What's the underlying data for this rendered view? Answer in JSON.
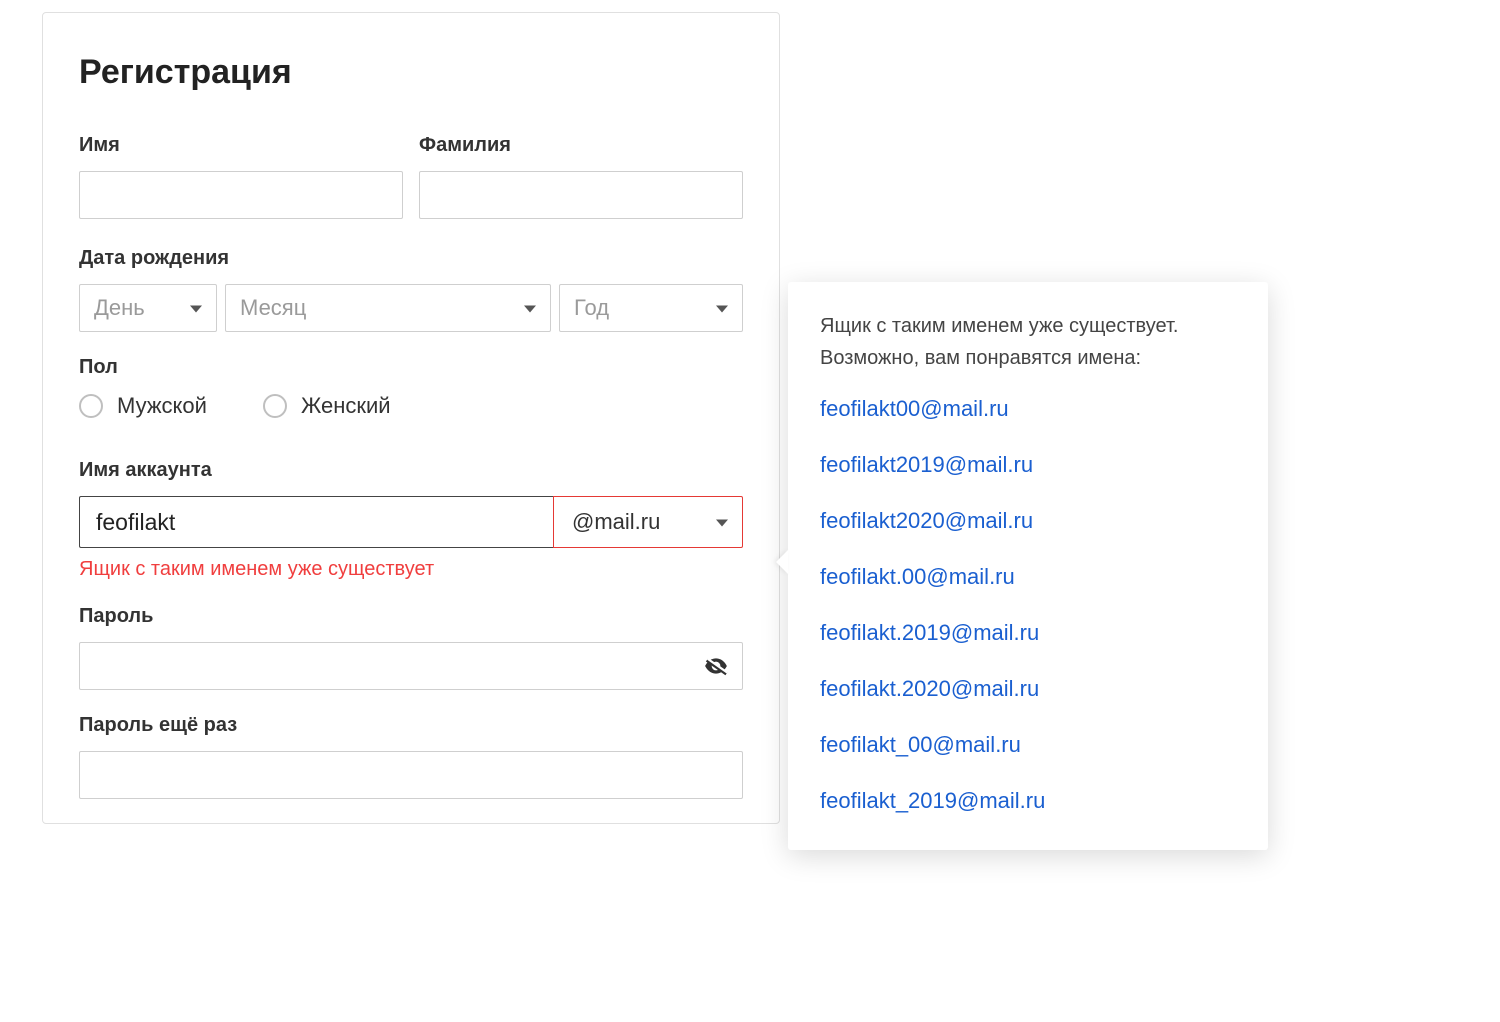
{
  "title": "Регистрация",
  "labels": {
    "first_name": "Имя",
    "last_name": "Фамилия",
    "dob": "Дата рождения",
    "gender": "Пол",
    "account": "Имя аккаунта",
    "password": "Пароль",
    "password_repeat": "Пароль ещё раз"
  },
  "dob": {
    "day_placeholder": "День",
    "month_placeholder": "Месяц",
    "year_placeholder": "Год"
  },
  "gender": {
    "male": "Мужской",
    "female": "Женский"
  },
  "account": {
    "value": "feofilakt",
    "domain": "@mail.ru",
    "error": "Ящик с таким именем уже существует"
  },
  "popover": {
    "line1": "Ящик с таким именем уже существует.",
    "line2": "Возможно, вам понравятся имена:",
    "suggestions": [
      "feofilakt00@mail.ru",
      "feofilakt2019@mail.ru",
      "feofilakt2020@mail.ru",
      "feofilakt.00@mail.ru",
      "feofilakt.2019@mail.ru",
      "feofilakt.2020@mail.ru",
      "feofilakt_00@mail.ru",
      "feofilakt_2019@mail.ru"
    ]
  },
  "colors": {
    "error": "#f03e3e",
    "link": "#1a5fd0",
    "border_error": "#e53935"
  }
}
